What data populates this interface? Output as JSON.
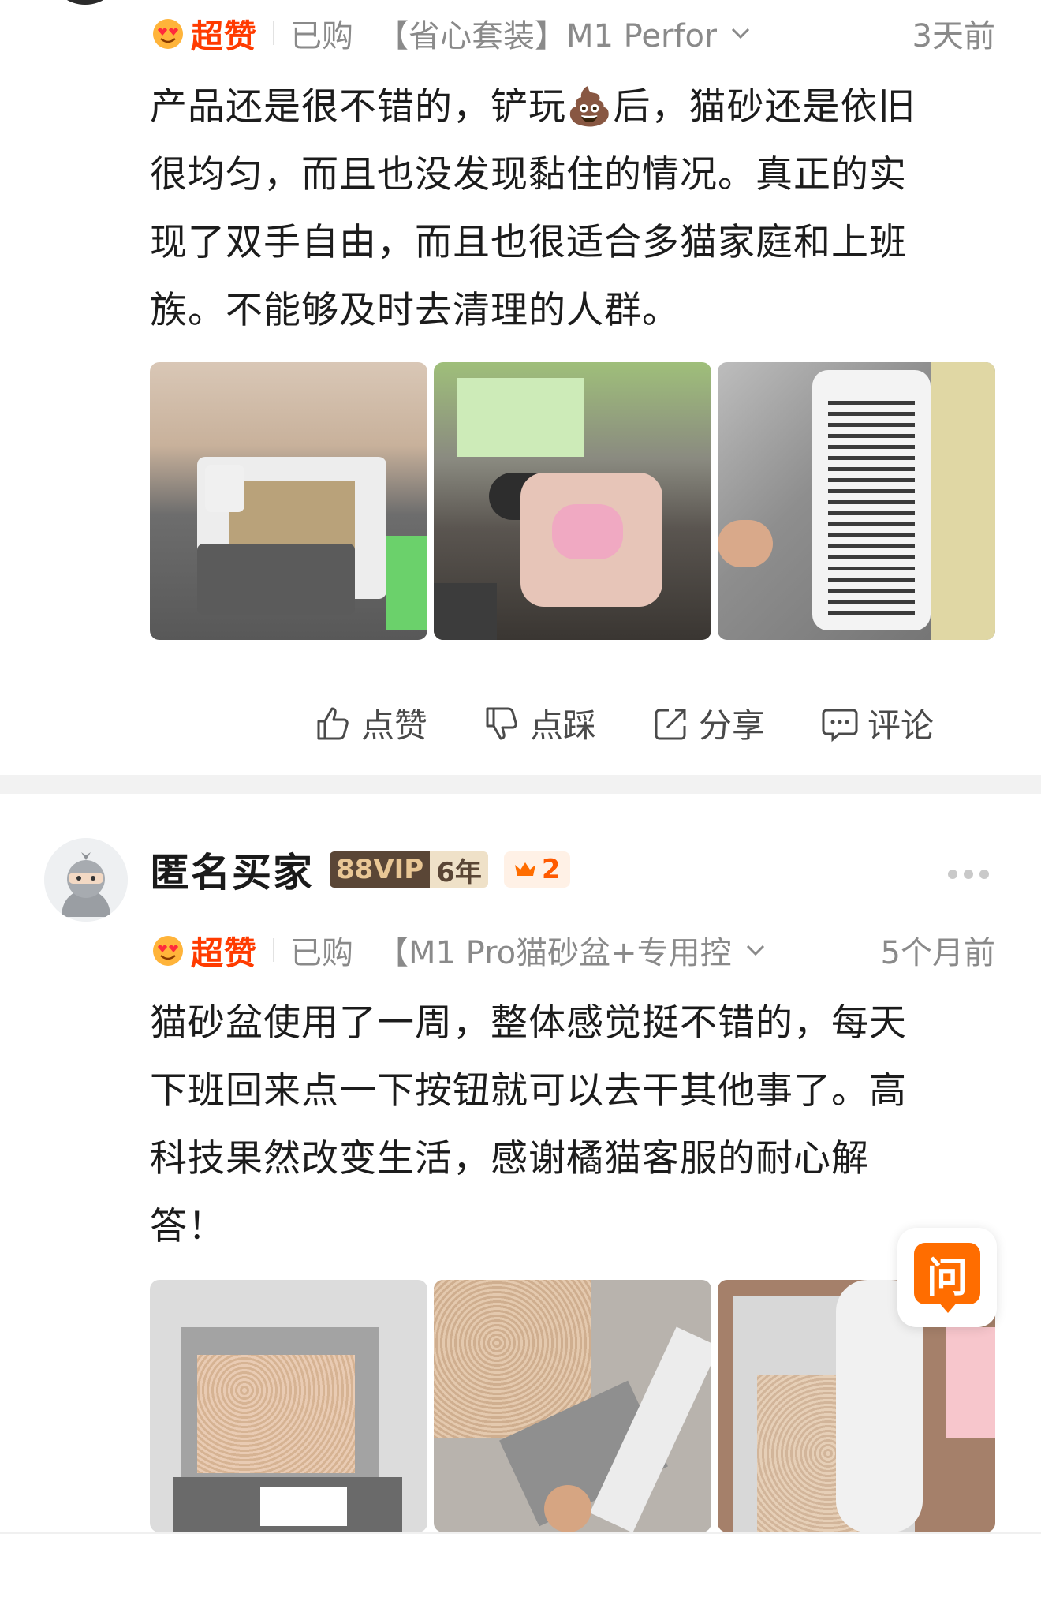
{
  "review1": {
    "rating_label": "超赞",
    "bought_label": "已购",
    "sku": "【省心套装】M1 Perfor",
    "time": "3天前",
    "text_lines": [
      "产品还是很不错的，铲玩💩后，猫砂还是依旧",
      "很均匀，而且也没发现黏住的情况。真正的实",
      "现了双手自由，而且也很适合多猫家庭和上班",
      "族。不能够及时去清理的人群。"
    ]
  },
  "actions": {
    "like": "点赞",
    "dislike": "点踩",
    "share": "分享",
    "comment": "评论"
  },
  "review2": {
    "username": "匿名买家",
    "vip_label": "88VIP",
    "vip_years": "6年",
    "crown_count": "2",
    "rating_label": "超赞",
    "bought_label": "已购",
    "sku": "【M1 Pro猫砂盆+专用控",
    "time": "5个月前",
    "text_lines": [
      "猫砂盆使用了一周，整体感觉挺不错的，每天",
      "下班回来点一下按钮就可以去干其他事了。高",
      "科技果然改变生活，感谢橘猫客服的耐心解",
      "答！"
    ]
  },
  "ask_button": "问",
  "colors": {
    "accent": "#ff3b00",
    "secondary_text": "#8a8a8a",
    "ask_orange": "#ff6d00"
  }
}
